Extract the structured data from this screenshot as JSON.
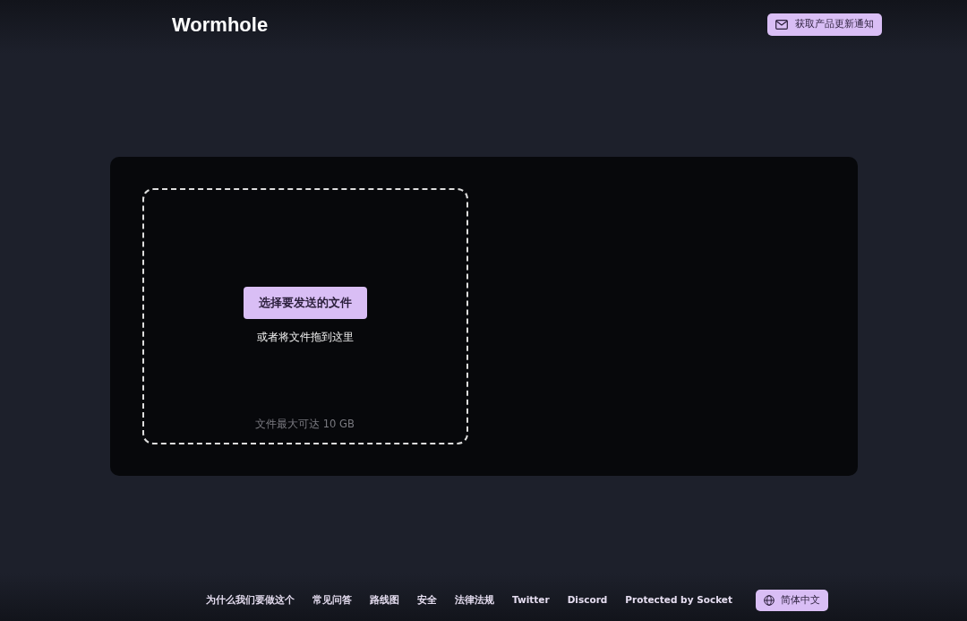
{
  "header": {
    "logo": "Wormhole",
    "notify_button": "获取产品更新通知"
  },
  "dropzone": {
    "choose_button": "选择要发送的文件",
    "drag_hint": "或者将文件拖到这里",
    "size_limit": "文件最大可达 10 GB"
  },
  "footer": {
    "links": [
      "为什么我们要做这个",
      "常见问答",
      "路线图",
      "安全",
      "法律法规",
      "Twitter",
      "Discord",
      "Protected by Socket"
    ],
    "language_button": "简体中文"
  }
}
